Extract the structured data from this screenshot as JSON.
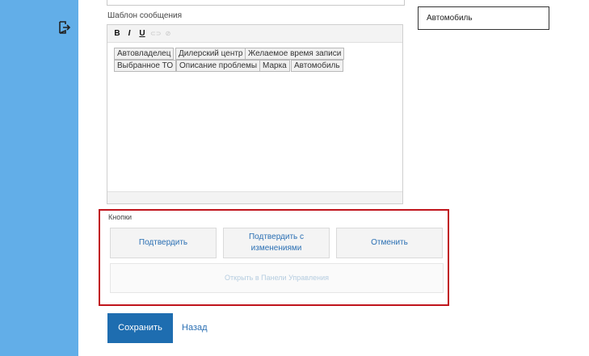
{
  "editor": {
    "label": "Шаблон сообщения",
    "toolbar": {
      "bold_icon": "bold-icon",
      "italic_icon": "italic-icon",
      "underline_icon": "underline-icon",
      "link_icon": "link-icon",
      "unlink_icon": "unlink-icon"
    },
    "tokens": [
      "Автовладелец",
      "Дилерский центр",
      "Желаемое время записи",
      "Выбранное ТО",
      "Описание проблемы",
      "Марка",
      "Автомобиль"
    ]
  },
  "side_field": {
    "value": "Автомобиль"
  },
  "buttons_group": {
    "label": "Кнопки",
    "confirm": "Подтвердить",
    "confirm_with_changes": "Подтвердить с изменениями",
    "cancel": "Отменить",
    "open_in_panel": "Открыть в Панели Управления"
  },
  "footer": {
    "save": "Сохранить",
    "back": "Назад"
  },
  "colors": {
    "sidebar": "#62aee8",
    "highlight_border": "#c0141c",
    "primary_button": "#1e6db0",
    "link": "#2a6fb3"
  }
}
